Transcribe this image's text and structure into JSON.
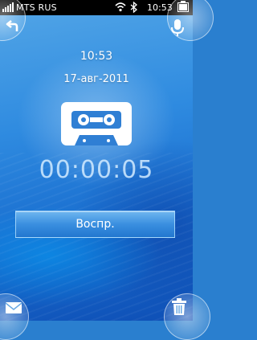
{
  "status_bar": {
    "carrier": "MTS RUS",
    "time": "10:53",
    "icons": [
      "signal-icon",
      "wifi-icon",
      "bluetooth-icon",
      "battery-icon"
    ]
  },
  "recorder": {
    "clock": "10:53",
    "date": "17-авг-2011",
    "timer": "00:00:05",
    "play_label": "Воспр."
  },
  "corner_buttons": {
    "top_left": "back-arrow-icon",
    "top_right": "microphone-icon",
    "bottom_left": "envelope-icon",
    "bottom_right": "trash-icon"
  },
  "colors": {
    "background_top": "#4fa3e6",
    "background_bottom": "#0e4fb6",
    "status_bar": "#000000",
    "button": "#3a8fe0"
  }
}
